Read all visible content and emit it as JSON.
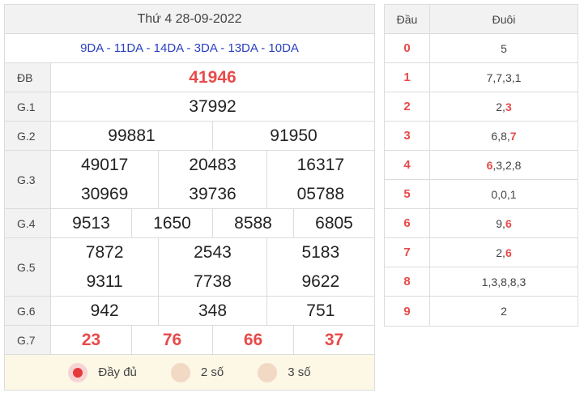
{
  "results": {
    "title": "Thứ 4 28-09-2022",
    "codes": "9DA - 11DA - 14DA - 3DA - 13DA - 10DA",
    "prizes": {
      "db": {
        "label": "ĐB",
        "values": [
          "41946"
        ]
      },
      "g1": {
        "label": "G.1",
        "values": [
          "37992"
        ]
      },
      "g2": {
        "label": "G.2",
        "values": [
          "99881",
          "91950"
        ]
      },
      "g3": {
        "label": "G.3",
        "values": [
          "49017",
          "20483",
          "16317",
          "30969",
          "39736",
          "05788"
        ]
      },
      "g4": {
        "label": "G.4",
        "values": [
          "9513",
          "1650",
          "8588",
          "6805"
        ]
      },
      "g5": {
        "label": "G.5",
        "values": [
          "7872",
          "2543",
          "5183",
          "9311",
          "7738",
          "9622"
        ]
      },
      "g6": {
        "label": "G.6",
        "values": [
          "942",
          "348",
          "751"
        ]
      },
      "g7": {
        "label": "G.7",
        "values": [
          "23",
          "76",
          "66",
          "37"
        ]
      }
    },
    "modes": [
      {
        "label": "Đầy đủ",
        "selected": true
      },
      {
        "label": "2 số",
        "selected": false
      },
      {
        "label": "3 số",
        "selected": false
      }
    ]
  },
  "headtail": {
    "head_label": "Đầu",
    "tail_label": "Đuôi",
    "rows": [
      {
        "head": "0",
        "tails": [
          {
            "v": "5",
            "hl": false
          }
        ]
      },
      {
        "head": "1",
        "tails": [
          {
            "v": "7",
            "hl": false
          },
          {
            "v": "7",
            "hl": false
          },
          {
            "v": "3",
            "hl": false
          },
          {
            "v": "1",
            "hl": false
          }
        ]
      },
      {
        "head": "2",
        "tails": [
          {
            "v": "2",
            "hl": false
          },
          {
            "v": "3",
            "hl": true
          }
        ]
      },
      {
        "head": "3",
        "tails": [
          {
            "v": "6",
            "hl": false
          },
          {
            "v": "8",
            "hl": false
          },
          {
            "v": "7",
            "hl": true
          }
        ]
      },
      {
        "head": "4",
        "tails": [
          {
            "v": "6",
            "hl": true
          },
          {
            "v": "3",
            "hl": false
          },
          {
            "v": "2",
            "hl": false
          },
          {
            "v": "8",
            "hl": false
          }
        ]
      },
      {
        "head": "5",
        "tails": [
          {
            "v": "0",
            "hl": false
          },
          {
            "v": "0",
            "hl": false
          },
          {
            "v": "1",
            "hl": false
          }
        ]
      },
      {
        "head": "6",
        "tails": [
          {
            "v": "9",
            "hl": false
          },
          {
            "v": "6",
            "hl": true
          }
        ]
      },
      {
        "head": "7",
        "tails": [
          {
            "v": "2",
            "hl": false
          },
          {
            "v": "6",
            "hl": true
          }
        ]
      },
      {
        "head": "8",
        "tails": [
          {
            "v": "1",
            "hl": false
          },
          {
            "v": "3",
            "hl": false
          },
          {
            "v": "8",
            "hl": false
          },
          {
            "v": "8",
            "hl": false
          },
          {
            "v": "3",
            "hl": false
          }
        ]
      },
      {
        "head": "9",
        "tails": [
          {
            "v": "2",
            "hl": false
          }
        ]
      }
    ]
  },
  "colors": {
    "accent_red": "#e84a4a",
    "code_blue": "#2a3fbf",
    "label_bg": "#f2f2f2",
    "mode_bg": "#fdf7e6"
  }
}
